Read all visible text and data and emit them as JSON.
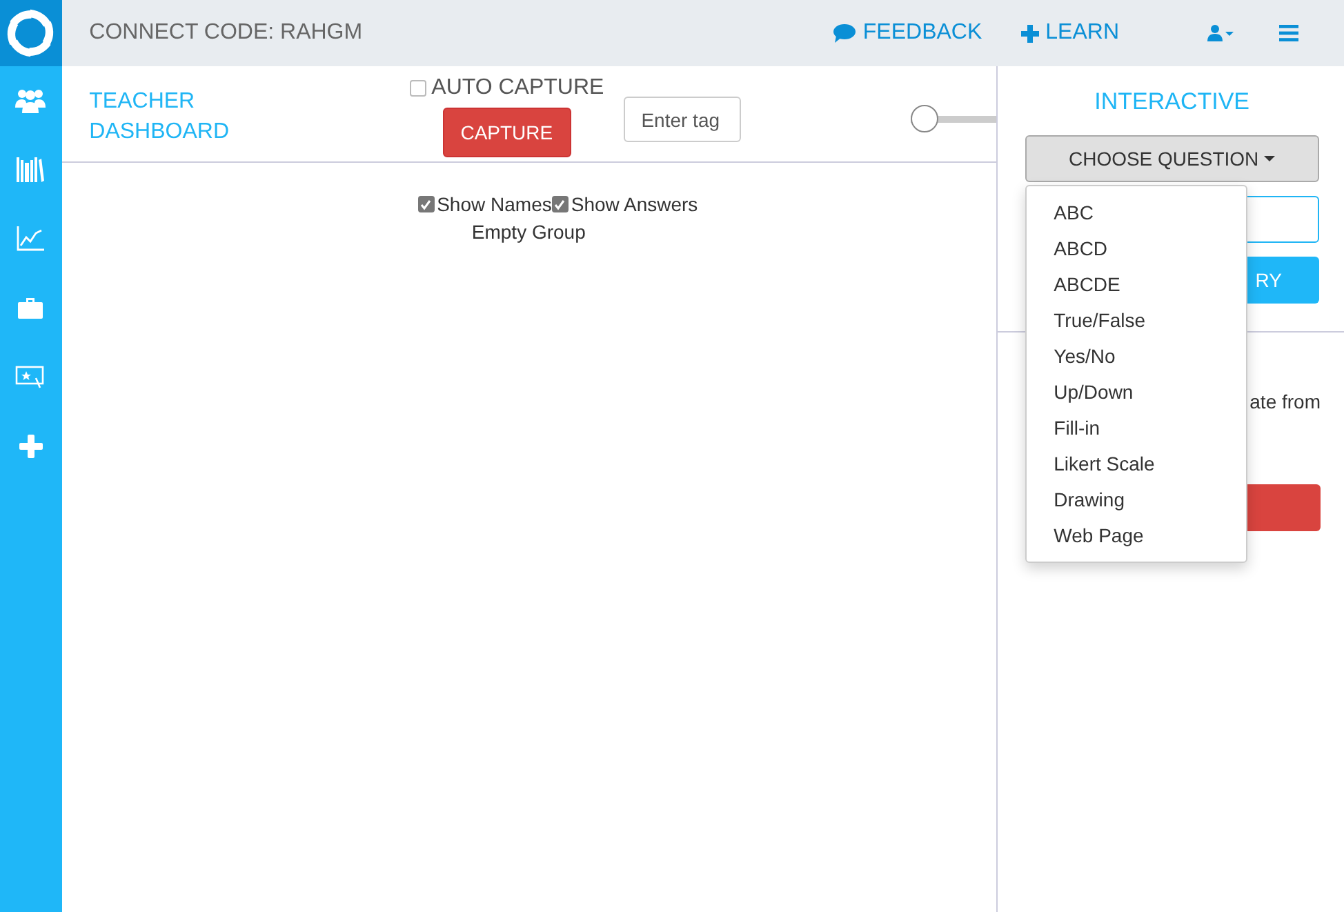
{
  "header": {
    "connect_code": "CONNECT CODE: RAHGM",
    "links": [
      {
        "kind": "feedback",
        "label": "FEEDBACK"
      },
      {
        "kind": "learn",
        "label": "LEARN"
      }
    ]
  },
  "sidebar": {
    "items": [
      {
        "kind": "people"
      },
      {
        "kind": "library"
      },
      {
        "kind": "chart"
      },
      {
        "kind": "briefcase"
      },
      {
        "kind": "whiteboard"
      },
      {
        "kind": "add"
      }
    ]
  },
  "dashboard": {
    "title": "TEACHER DASHBOARD",
    "auto_capture": {
      "label": "AUTO CAPTURE",
      "checked": false
    },
    "capture_button": "CAPTURE",
    "tag_field": {
      "placeholder": "Enter tag"
    },
    "slider": {
      "level": 0
    },
    "options": [
      {
        "label": "Show Names",
        "checked": true
      },
      {
        "label": "Show Answers",
        "checked": true
      }
    ],
    "group_text": "Empty Group"
  },
  "interactive": {
    "title": "INTERACTIVE",
    "choose_button": "CHOOSE QUESTION",
    "start_button": "RY",
    "note": "ate from",
    "menu": {
      "items": [
        "ABC",
        "ABCD",
        "ABCDE",
        "True/False",
        "Yes/No",
        "Up/Down",
        "Fill-in",
        "Likert Scale",
        "Drawing",
        "Web Page"
      ]
    }
  }
}
